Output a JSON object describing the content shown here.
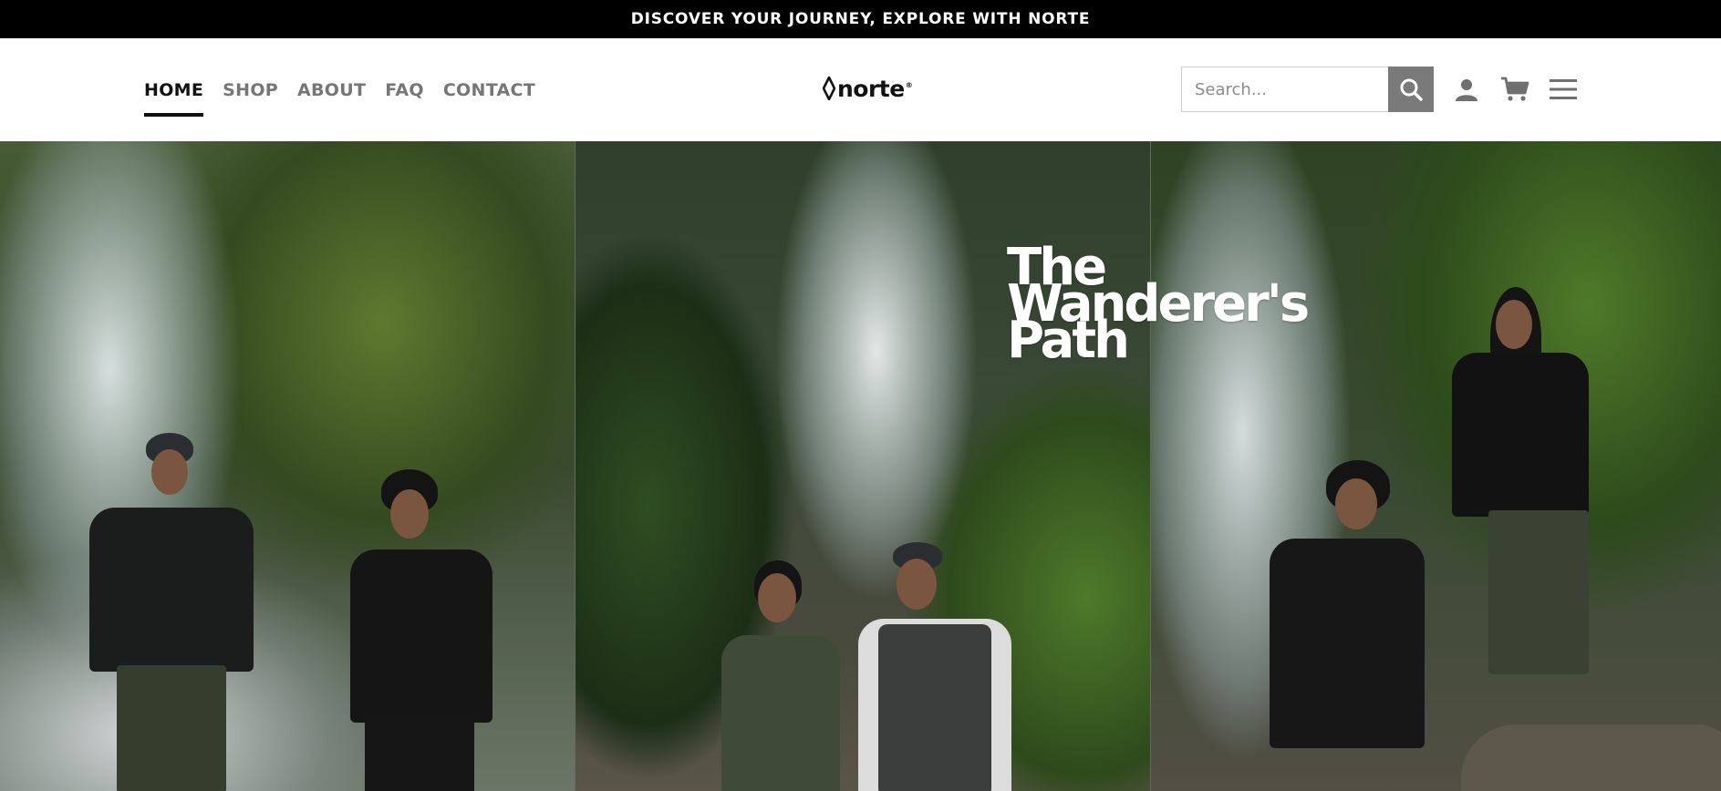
{
  "announcement": "DISCOVER YOUR JOURNEY, EXPLORE WITH NORTE",
  "nav": {
    "items": [
      {
        "label": "HOME",
        "active": true
      },
      {
        "label": "SHOP",
        "active": false
      },
      {
        "label": "ABOUT",
        "active": false
      },
      {
        "label": "FAQ",
        "active": false
      },
      {
        "label": "CONTACT",
        "active": false
      }
    ]
  },
  "logo": {
    "text": "norte",
    "icon": "diamond-outline-icon"
  },
  "search": {
    "placeholder": "Search...",
    "value": "",
    "button_icon": "search-icon"
  },
  "header_icons": [
    "user-icon",
    "cart-icon",
    "hamburger-menu-icon"
  ],
  "hero": {
    "title_lines": [
      "The",
      "Wanderer's",
      "Path"
    ]
  },
  "colors": {
    "announcement_bg": "#000000",
    "nav_active": "#111111",
    "nav_inactive": "#767676",
    "search_button": "#7a7a7a"
  }
}
